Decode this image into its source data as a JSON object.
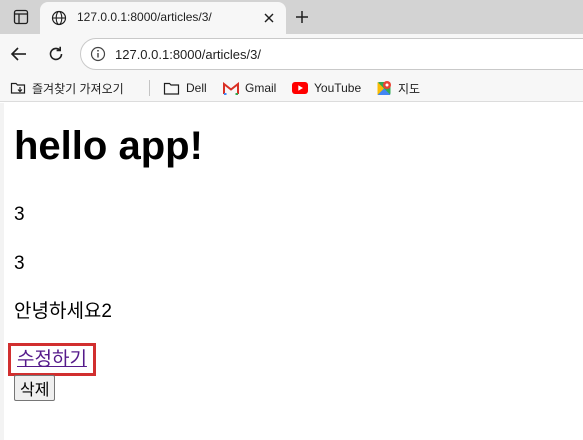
{
  "browser": {
    "tab": {
      "title": "127.0.0.1:8000/articles/3/"
    },
    "address_bar": {
      "url": "127.0.0.1:8000/articles/3/"
    },
    "bookmarks": {
      "import_label": "즐겨찾기 가져오기",
      "items": [
        {
          "label": "Dell",
          "icon": "folder-icon"
        },
        {
          "label": "Gmail",
          "icon": "gmail-icon"
        },
        {
          "label": "YouTube",
          "icon": "youtube-icon"
        },
        {
          "label": "지도",
          "icon": "maps-icon"
        }
      ]
    }
  },
  "page": {
    "title": "hello app!",
    "article_id": "3",
    "article_title": "3",
    "article_content": "안녕하세요2",
    "edit_link": "수정하기",
    "delete_button": "삭제"
  },
  "colors": {
    "link": "#551a8b",
    "highlight": "#d12f2f",
    "tabstrip": "#d3d3d3",
    "toolbar": "#f7f7f7"
  }
}
